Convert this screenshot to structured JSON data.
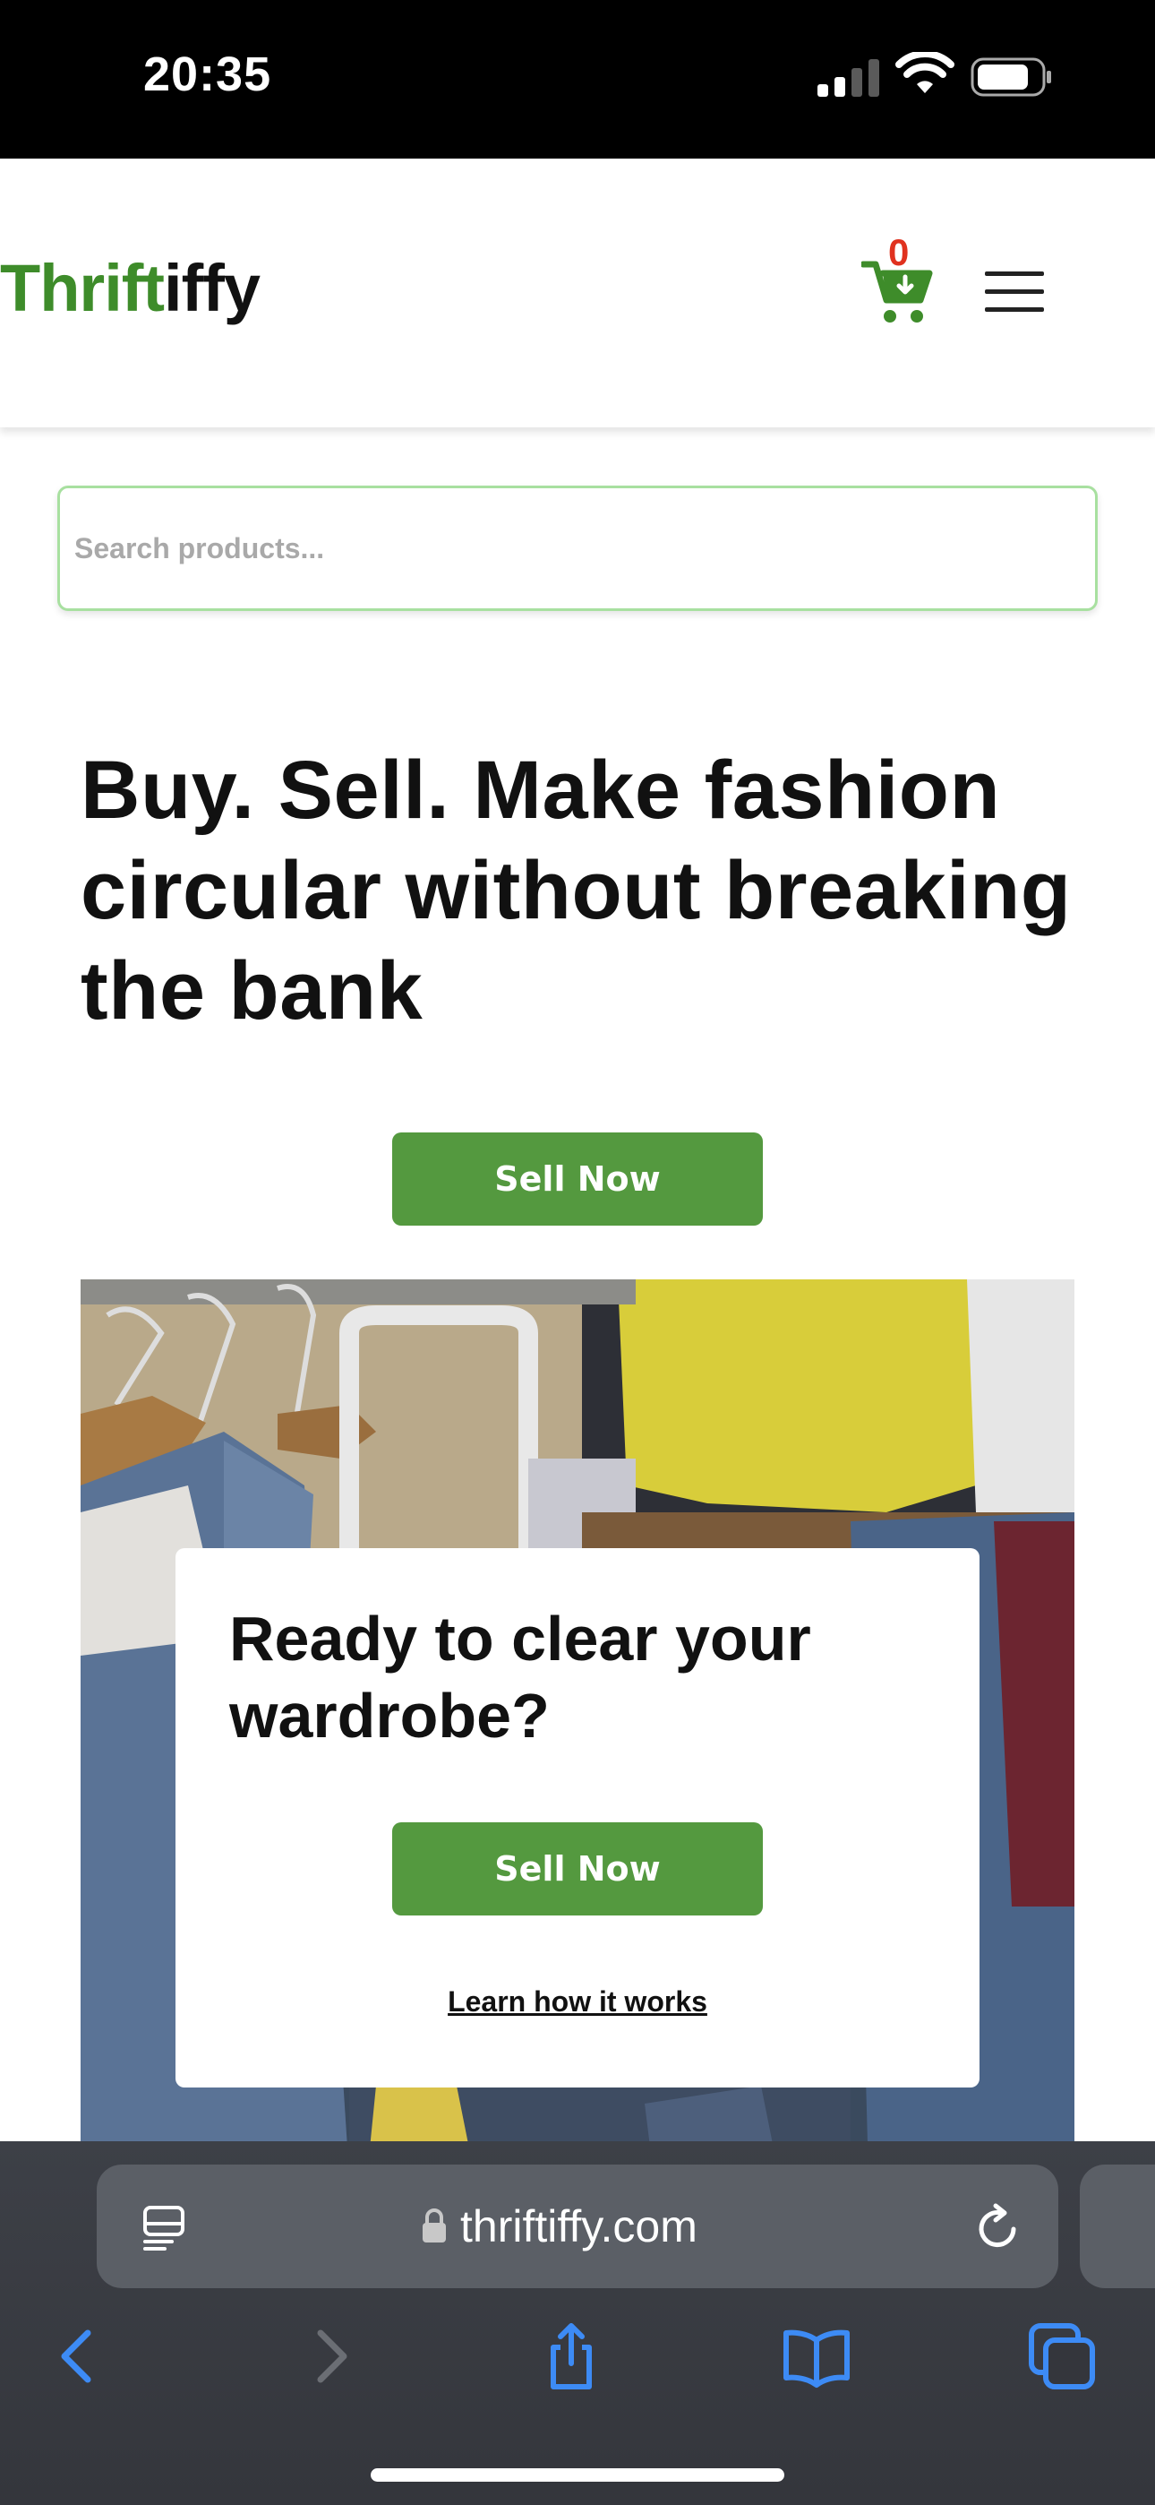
{
  "status_bar": {
    "time": "20:35"
  },
  "header": {
    "logo_part1": "Thrift",
    "logo_part2": "iffy",
    "cart_count": "0",
    "icons": [
      "cart-icon",
      "hamburger-menu-icon"
    ]
  },
  "search": {
    "placeholder": "Search products..."
  },
  "hero": {
    "title": "Buy. Sell. Make fashion circular without breaking the bank",
    "sell_button": "Sell Now"
  },
  "promo": {
    "title": "Ready to clear your wardrobe?",
    "sell_button": "Sell Now",
    "learn_link": "Learn how it works"
  },
  "browser": {
    "url": "thriftiffy.com",
    "icons": [
      "reader-icon",
      "lock-icon",
      "reload-icon",
      "back-icon",
      "forward-icon",
      "share-icon",
      "bookmarks-icon",
      "tabs-icon"
    ]
  },
  "colors": {
    "brand_green": "#3e8c2a",
    "button_green": "#54993f",
    "cart_badge_red": "#e0321f",
    "search_border": "#a8e0a0"
  }
}
